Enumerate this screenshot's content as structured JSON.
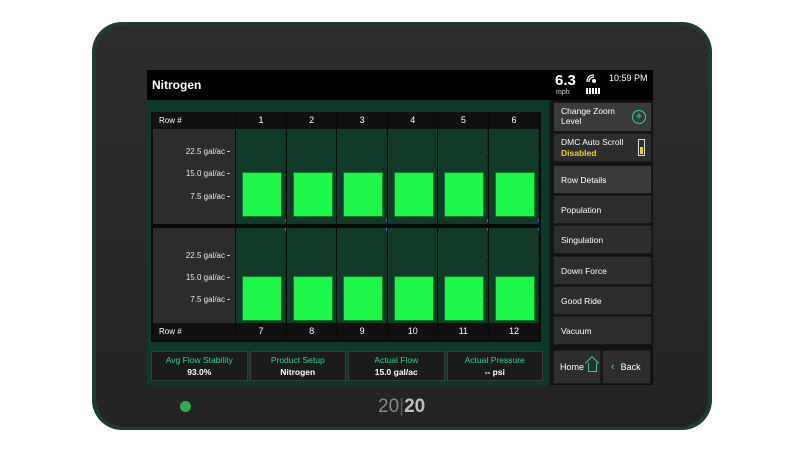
{
  "header": {
    "title": "Nitrogen",
    "speed": "6.3",
    "speed_unit": "mph",
    "time": "10:59 PM"
  },
  "chart": {
    "row_label": "Row #",
    "y_ticks": [
      "22.5 gal/ac",
      "15.0 gal/ac",
      "7.5 gal/ac"
    ],
    "top_rows": [
      "1",
      "2",
      "3",
      "4",
      "5",
      "6"
    ],
    "bottom_rows": [
      "7",
      "8",
      "9",
      "10",
      "11",
      "12"
    ],
    "bar_color": "#1ef64a"
  },
  "chart_data": {
    "type": "bar",
    "categories": [
      "1",
      "2",
      "3",
      "4",
      "5",
      "6",
      "7",
      "8",
      "9",
      "10",
      "11",
      "12"
    ],
    "values": [
      15.0,
      15.0,
      15.0,
      15.0,
      15.0,
      15.0,
      15.0,
      15.0,
      15.0,
      15.0,
      15.0,
      15.0
    ],
    "title": "Nitrogen",
    "xlabel": "Row #",
    "ylabel": "",
    "ylim": [
      0,
      30
    ]
  },
  "status": [
    {
      "label": "Avg Flow Stability",
      "value": "93.0%"
    },
    {
      "label": "Product Setup",
      "value": "Nitrogen"
    },
    {
      "label": "Actual Flow",
      "value": "15.0 gal/ac"
    },
    {
      "label": "Actual Pressure",
      "value": "-- psi"
    }
  ],
  "menu": {
    "zoom": "Change Zoom Level",
    "dmc_title": "DMC Auto Scroll",
    "dmc_status": "Disabled",
    "items": [
      "Row Details",
      "Population",
      "Singulation",
      "Down Force",
      "Good Ride",
      "Vacuum"
    ],
    "home": "Home",
    "back": "Back"
  },
  "device": {
    "brand_left": "20",
    "brand_right": "20"
  }
}
